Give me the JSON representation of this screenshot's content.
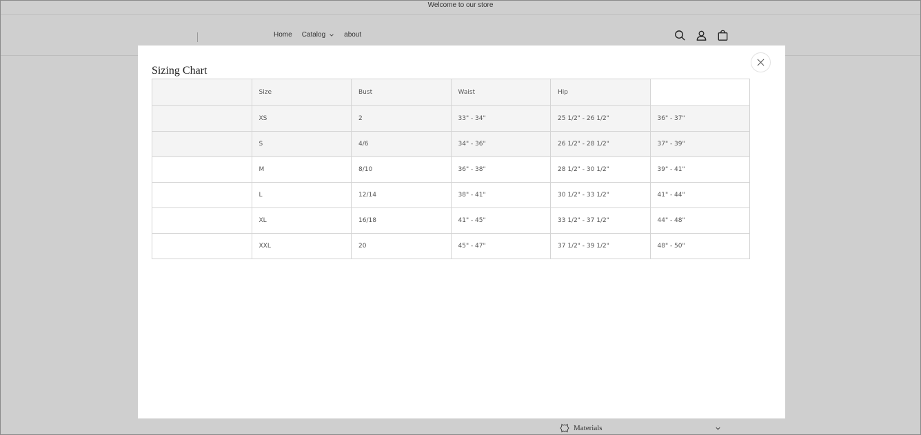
{
  "announcement": {
    "text": "Welcome to our store"
  },
  "header": {
    "nav": [
      {
        "label": "Home"
      },
      {
        "label": "Catalog",
        "has_dropdown": true
      },
      {
        "label": "about"
      }
    ],
    "icons": [
      "search-icon",
      "account-icon",
      "cart-icon"
    ]
  },
  "modal": {
    "title": "Sizing Chart",
    "close_icon": "close-icon",
    "table": {
      "headers": [
        "",
        "Size",
        "Bust",
        "Waist",
        "Hip",
        ""
      ],
      "rows": [
        [
          "",
          "XS",
          "2",
          "33\" - 34\"",
          "25 1/2\" - 26 1/2\"",
          "36\" - 37\""
        ],
        [
          "",
          "S",
          "4/6",
          "34\" - 36\"",
          "26 1/2\" - 28 1/2\"",
          "37\" - 39\""
        ],
        [
          "",
          "M",
          "8/10",
          "36\" - 38\"",
          "28 1/2\" - 30 1/2\"",
          "39\" - 41\""
        ],
        [
          "",
          "L",
          "12/14",
          "38\" - 41\"",
          "30 1/2\" - 33 1/2\"",
          "41\" - 44\""
        ],
        [
          "",
          "XL",
          "16/18",
          "41\" - 45\"",
          "33 1/2\" - 37 1/2\"",
          "44\" - 48\""
        ],
        [
          "",
          "XXL",
          "20",
          "45\" - 47\"",
          "37 1/2\" - 39 1/2\"",
          "48\" - 50\""
        ]
      ]
    }
  },
  "below_modal": {
    "label": "Materials",
    "icon": "leather-icon"
  },
  "colors": {
    "overlay": "#cfcfcf",
    "modal_bg": "#ffffff",
    "row_shade": "#f4f4f4",
    "border": "#d4d4d4"
  }
}
